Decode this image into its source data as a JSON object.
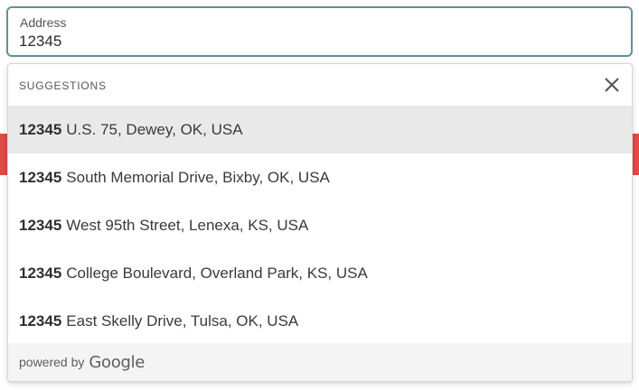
{
  "address": {
    "label": "Address",
    "value": "12345"
  },
  "suggestions": {
    "title": "SUGGESTIONS",
    "close_icon": "close-icon",
    "items": [
      {
        "match": "12345",
        "rest": "U.S. 75, Dewey, OK, USA",
        "highlighted": true
      },
      {
        "match": "12345",
        "rest": "South Memorial Drive, Bixby, OK, USA",
        "highlighted": false
      },
      {
        "match": "12345",
        "rest": "West 95th Street, Lenexa, KS, USA",
        "highlighted": false
      },
      {
        "match": "12345",
        "rest": "College Boulevard, Overland Park, KS, USA",
        "highlighted": false
      },
      {
        "match": "12345",
        "rest": "East Skelly Drive, Tulsa, OK, USA",
        "highlighted": false
      }
    ]
  },
  "footer": {
    "powered_by": "powered by",
    "brand": "Google"
  },
  "colors": {
    "field_border": "#5f9398",
    "highlight_row": "#e9e9e9",
    "under_strip": "#e24a46"
  }
}
